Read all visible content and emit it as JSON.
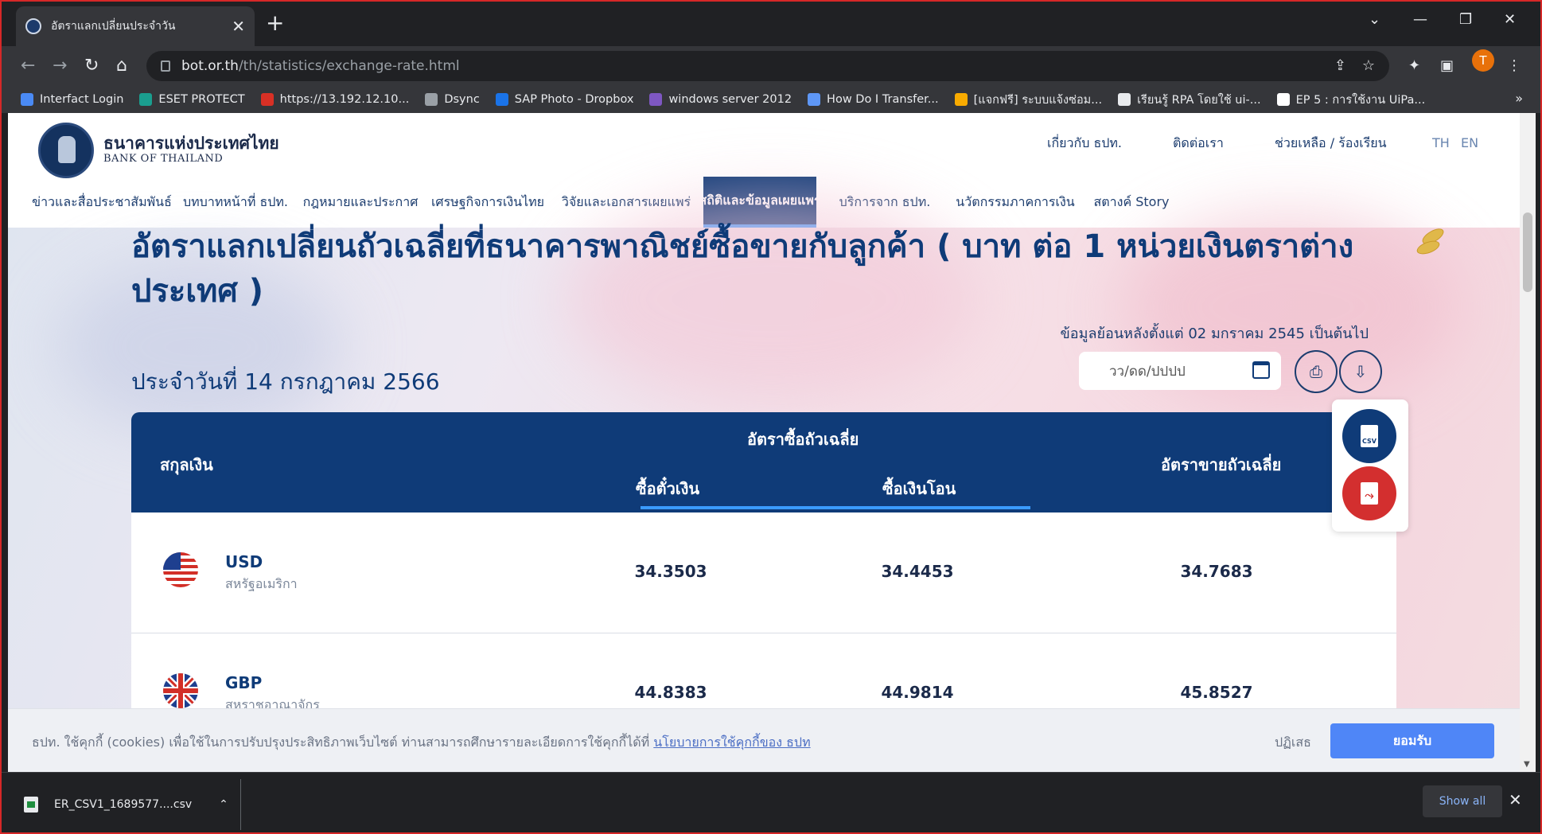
{
  "browser": {
    "tab_title": "อัตราแลกเปลี่ยนประจำวัน",
    "url_host": "bot.or.th",
    "url_path": "/th/statistics/exchange-rate.html",
    "avatar_letter": "T",
    "bookmarks": [
      {
        "label": "Interfact Login",
        "color": "#4a8af4"
      },
      {
        "label": "ESET PROTECT",
        "color": "#1a9e8f"
      },
      {
        "label": "https://13.192.12.10...",
        "color": "#d93025"
      },
      {
        "label": "Dsync",
        "color": "#9aa0a6"
      },
      {
        "label": "SAP Photo - Dropbox",
        "color": "#1a73e8"
      },
      {
        "label": "windows server 2012",
        "color": "#7e57c2"
      },
      {
        "label": "How Do I Transfer...",
        "color": "#5e97f6"
      },
      {
        "label": "[แจกฟรี] ระบบแจ้งซ่อม...",
        "color": "#f9ab00"
      },
      {
        "label": "เรียนรู้ RPA โดยใช้ ui-...",
        "color": "#e8eaed"
      },
      {
        "label": "EP 5 : การใช้งาน UiPa...",
        "color": "#ffffff"
      }
    ],
    "bookmarks_more": "»"
  },
  "site": {
    "brand_th": "ธนาคารแห่งประเทศไทย",
    "brand_en": "BANK OF THAILAND",
    "top_links": [
      "เกี่ยวกับ ธปท.",
      "ติดต่อเรา",
      "ช่วยเหลือ / ร้องเรียน"
    ],
    "lang_th": "TH",
    "lang_en": "EN",
    "menu": [
      "ข่าวและสื่อประชาสัมพันธ์",
      "บทบาทหน้าที่ ธปท.",
      "กฎหมายและประกาศ",
      "เศรษฐกิจการเงินไทย",
      "วิจัยและเอกสารเผยแพร่",
      "สถิติและข้อมูลเผยแพร่",
      "บริการจาก ธปท.",
      "นวัตกรรมภาคการเงิน",
      "สตางค์ Story"
    ],
    "active_menu_index": 5
  },
  "main": {
    "title": "อัตราแลกเปลี่ยนถัวเฉลี่ยที่ธนาคารพาณิชย์ซื้อขายกับลูกค้า ( บาท ต่อ 1 หน่วยเงินตราต่างประเทศ )",
    "since_note": "ข้อมูลย้อนหลังตั้งแต่ 02 มกราคม 2545 เป็นต้นไป",
    "date_label": "ประจำวันที่ 14 กรกฎาคม 2566",
    "date_placeholder": "วว/ดด/ปปปป",
    "csv_label": "CSV",
    "table": {
      "col_currency": "สกุลเงิน",
      "col_buy_group": "อัตราซื้อถัวเฉลี่ย",
      "col_buy_cash": "ซื้อตั๋วเงิน",
      "col_buy_transfer": "ซื้อเงินโอน",
      "col_sell": "อัตราขายถัวเฉลี่ย",
      "rows": [
        {
          "code": "USD",
          "name": "สหรัฐอเมริกา",
          "buy_cash": "34.3503",
          "buy_transfer": "34.4453",
          "sell": "34.7683"
        },
        {
          "code": "GBP",
          "name": "สหราชอาณาจักร",
          "buy_cash": "44.8383",
          "buy_transfer": "44.9814",
          "sell": "45.8527"
        }
      ]
    }
  },
  "cookie": {
    "text": "ธปท. ใช้คุกกี้ (cookies) เพื่อใช้ในการปรับปรุงประสิทธิภาพเว็บไซต์ ท่านสามารถศึกษารายละเอียดการใช้คุกกี้ได้ที่",
    "link": "นโยบายการใช้คุกกี้ของ ธปท",
    "reject": "ปฏิเสธ",
    "accept": "ยอมรับ"
  },
  "downloads": {
    "file": "ER_CSV1_1689577....csv",
    "show_all": "Show all"
  },
  "colors": {
    "primary": "#0f3b78",
    "accent": "#3a9bff",
    "pdf_red": "#d32f2f"
  }
}
